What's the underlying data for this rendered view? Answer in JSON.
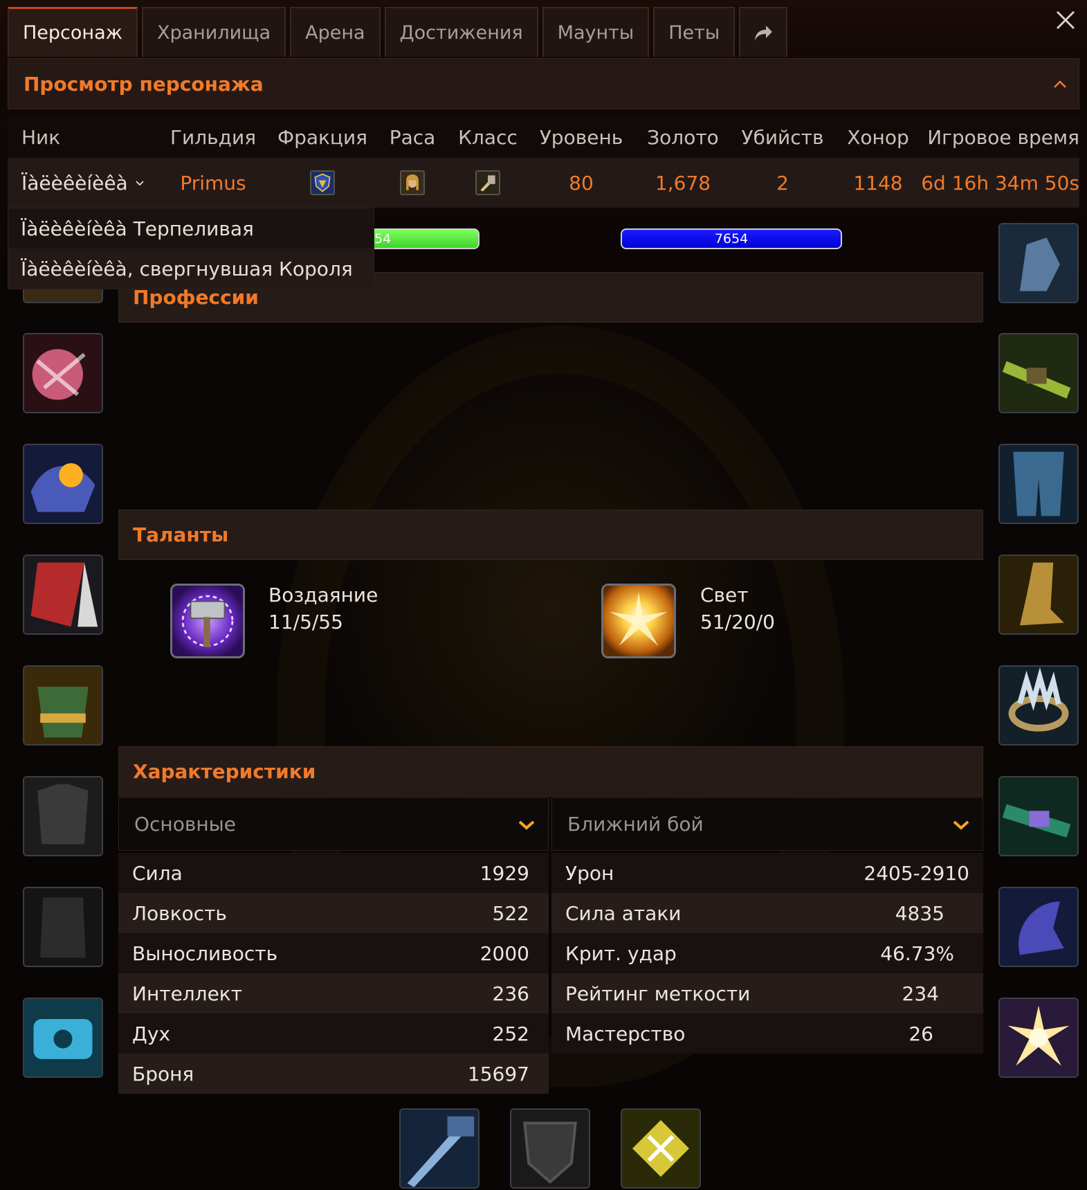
{
  "tabs": [
    {
      "label": "Персонаж",
      "active": true
    },
    {
      "label": "Хранилища"
    },
    {
      "label": "Арена"
    },
    {
      "label": "Достижения"
    },
    {
      "label": "Маунты"
    },
    {
      "label": "Петы"
    }
  ],
  "icons": {
    "share": "share-arrow-icon",
    "close": "close-icon",
    "collapse": "chevron-up-icon",
    "nick_chevron": "chevron-down-icon",
    "select_arrow": "chevron-down-icon"
  },
  "colors": {
    "accent": "#f07a2a",
    "tab_active_border": "#c44a1c",
    "bar_green": "#3ed42a",
    "bar_blue": "#0000d6"
  },
  "character_view": {
    "title": "Просмотр персонажа",
    "columns": [
      "Ник",
      "Гильдия",
      "Фракция",
      "Раса",
      "Класс",
      "Уровень",
      "Золото",
      "Убийств",
      "Хонор",
      "Игровое время"
    ],
    "row": {
      "nick": "Ïàëèêèíèêà",
      "guild": "Primus",
      "faction_icon": "alliance-crest-icon",
      "race_icon": "human-female-portrait-icon",
      "class_icon": "paladin-class-icon",
      "level": "80",
      "gold": "1,678",
      "kills": "2",
      "honor": "1148",
      "playtime": "6d 16h 34m 50s"
    },
    "nick_dropdown": [
      "Ïàëèêèíèêà Терпеливая",
      "Ïàëèêèíèêà, свергнувшая Короля"
    ]
  },
  "bars": {
    "health_partial": "54",
    "mana": "7654"
  },
  "professions": {
    "title": "Профессии"
  },
  "talents": {
    "title": "Таланты",
    "specs": [
      {
        "name": "Воздаяние",
        "points": "11/5/55",
        "icon": "retribution-hammer-icon"
      },
      {
        "name": "Свет",
        "points": "51/20/0",
        "icon": "holy-light-icon"
      }
    ]
  },
  "stats": {
    "title": "Характеристики",
    "left_select": "Основные",
    "right_select": "Ближний бой",
    "base": [
      {
        "label": "Сила",
        "value": "1929"
      },
      {
        "label": "Ловкость",
        "value": "522"
      },
      {
        "label": "Выносливость",
        "value": "2000"
      },
      {
        "label": "Интеллект",
        "value": "236"
      },
      {
        "label": "Дух",
        "value": "252"
      },
      {
        "label": "Броня",
        "value": "15697"
      }
    ],
    "melee": [
      {
        "label": "Урон",
        "value": "2405-2910"
      },
      {
        "label": "Сила атаки",
        "value": "4835"
      },
      {
        "label": "Крит. удар",
        "value": "46.73%"
      },
      {
        "label": "Рейтинг меткости",
        "value": "234"
      },
      {
        "label": "Мастерство",
        "value": "26"
      }
    ]
  },
  "gear": {
    "left": [
      "helm-icon",
      "neck-icon",
      "shoulder-icon",
      "cloak-icon",
      "chest-icon",
      "shirt-icon",
      "tabard-icon",
      "bracer-icon"
    ],
    "right": [
      "gloves-icon",
      "belt-icon",
      "legs-icon",
      "boots-icon",
      "ring-icon",
      "ring-icon",
      "trinket-icon",
      "trinket-icon"
    ],
    "bottom": [
      "main-hand-icon",
      "off-hand-icon",
      "relic-icon"
    ]
  }
}
